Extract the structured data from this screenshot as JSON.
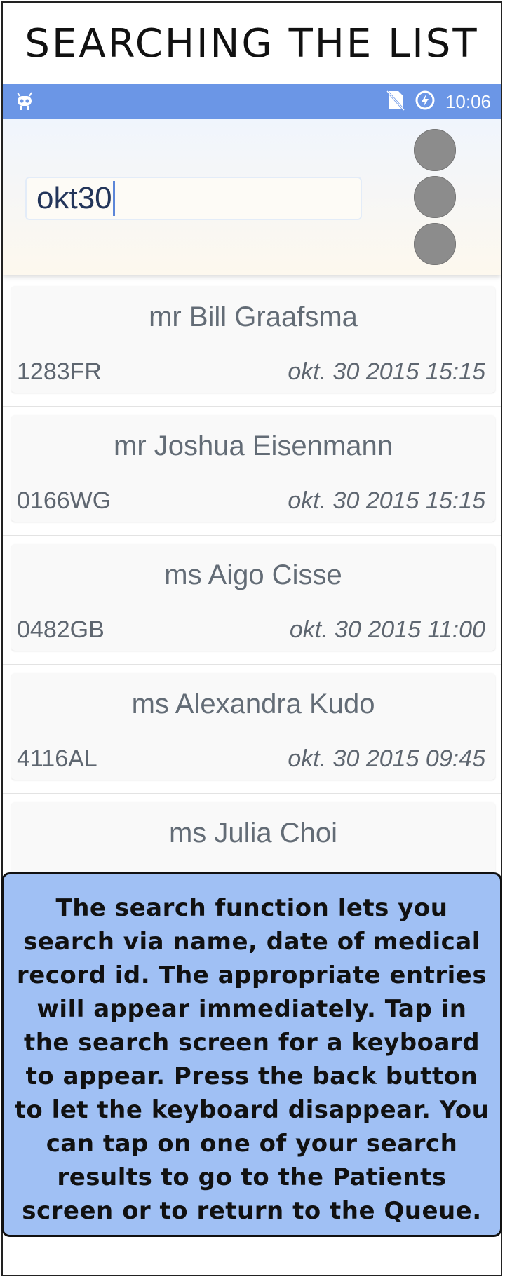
{
  "title": "SEARCHING THE LIST",
  "status_bar": {
    "time": "10:06",
    "icons": [
      "android-robot-icon",
      "no-sim-icon",
      "battery-charging-icon"
    ]
  },
  "search": {
    "value": "okt30"
  },
  "results": [
    {
      "name": "mr Bill Graafsma",
      "record_id": "1283FR",
      "datetime": "okt. 30 2015 15:15"
    },
    {
      "name": "mr Joshua Eisenmann",
      "record_id": "0166WG",
      "datetime": "okt. 30 2015 15:15"
    },
    {
      "name": "ms Aigo Cisse",
      "record_id": "0482GB",
      "datetime": "okt. 30 2015 11:00"
    },
    {
      "name": "ms Alexandra Kudo",
      "record_id": "4116AL",
      "datetime": "okt. 30 2015 09:45"
    },
    {
      "name": "ms Julia Choi",
      "record_id": "",
      "datetime": ""
    }
  ],
  "note": "The search function lets you search via name, date of medical record id. The appropriate entries will appear immediately. Tap in the search screen for a keyboard to appear. Press the back button to let the keyboard disappear. You can tap on one of your search results to go to the Patients screen or to return to the Queue."
}
